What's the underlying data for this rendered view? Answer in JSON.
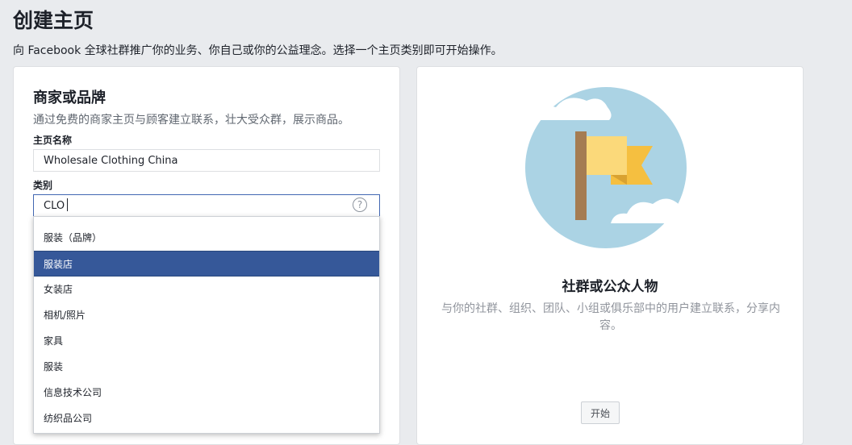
{
  "header": {
    "title": "创建主页",
    "subtitle": "向 Facebook 全球社群推广你的业务、你自己或你的公益理念。选择一个主页类别即可开始操作。"
  },
  "business": {
    "title": "商家或品牌",
    "description": "通过免费的商家主页与顾客建立联系，壮大受众群，展示商品。",
    "name_label": "主页名称",
    "name_value": "Wholesale Clothing China",
    "category_label": "类别",
    "category_value": "CLO",
    "help_glyph": "?",
    "suggestions": [
      "服装（品牌）",
      "服装店",
      "女装店",
      "相机/照片",
      "家具",
      "服装",
      "信息技术公司",
      "纺织品公司"
    ],
    "selected_index": 1
  },
  "community": {
    "title": "社群或公众人物",
    "description": "与你的社群、组织、团队、小组或俱乐部中的用户建立联系，分享内容。",
    "start_label": "开始"
  },
  "colors": {
    "background": "#e9ebee",
    "accent": "#4267b2",
    "selected_row": "#365899",
    "circle": "#abd3e4",
    "flag_light": "#fbd97a",
    "flag_dark": "#f5bf40",
    "pole": "#a57c52"
  },
  "icons": {
    "help": "help-circle-icon",
    "illustration": "flag-illustration"
  }
}
